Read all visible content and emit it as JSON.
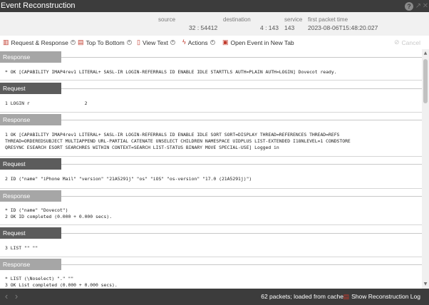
{
  "window": {
    "title": "Event Reconstruction",
    "help_icon": "?"
  },
  "meta": {
    "source_label": "source",
    "source_value": "32 : 54412",
    "destination_label": "destination",
    "destination_value": "4 : 143",
    "service_label": "service",
    "service_value": "143",
    "first_packet_label": "first packet time",
    "first_packet_value": "2023-08-06T15:48:20.027"
  },
  "toolbar": {
    "request_response": "Request & Response",
    "top_to_bottom": "Top To Bottom",
    "view_text": "View Text",
    "actions": "Actions",
    "open_event": "Open Event in New Tab",
    "cancel": "Cancel"
  },
  "sections": [
    {
      "kind": "Response",
      "lines": [
        "* OK [CAPABILITY IMAP4rev1 LITERAL+ SASL-IR LOGIN-REFERRALS ID ENABLE IDLE STARTTLS AUTH=PLAIN AUTH=LOGIN] Dovecot ready."
      ]
    },
    {
      "kind": "Request",
      "lines": [
        "1 LOGIN r                    2"
      ]
    },
    {
      "kind": "Response",
      "lines": [
        "1 OK [CAPABILITY IMAP4rev1 LITERAL+ SASL-IR LOGIN-REFERRALS ID ENABLE IDLE SORT SORT=DISPLAY THREAD=REFERENCES THREAD=REFS",
        "THREAD=ORDEREDSUBJECT MULTIAPPEND URL-PARTIAL CATENATE UNSELECT CHILDREN NAMESPACE UIDPLUS LIST-EXTENDED I18NLEVEL=1 CONDSTORE",
        "QRESYNC ESEARCH ESORT SEARCHRES WITHIN CONTEXT=SEARCH LIST-STATUS BINARY MOVE SPECIAL-USE] Logged in"
      ]
    },
    {
      "kind": "Request",
      "lines": [
        "2 ID (\"name\" \"iPhone Mail\" \"version\" \"21A5291j\" \"os\" \"iOS\" \"os-version\" \"17.0 (21A5291j)\")"
      ]
    },
    {
      "kind": "Response",
      "lines": [
        "* ID (\"name\" \"Dovecot\")",
        "2 OK ID completed (0.000 + 0.000 secs)."
      ]
    },
    {
      "kind": "Request",
      "lines": [
        "3 LIST \"\" \"\""
      ]
    },
    {
      "kind": "Response",
      "lines": [
        "* LIST (\\Noselect) \".\" \"\"",
        "3 OK List completed (0.000 + 0.000 secs)."
      ]
    }
  ],
  "footer": {
    "prev": "‹",
    "next": "›",
    "status": "62 packets; loaded from cache",
    "show_log": "Show Reconstruction Log"
  },
  "icons": {
    "help": "help-icon",
    "popout": "popout-icon",
    "close": "close-icon",
    "request_response": "split-view-icon",
    "top_to_bottom": "order-icon",
    "view_text": "document-icon",
    "actions": "lightning-icon",
    "open_event": "open-tab-icon",
    "cancel": "cancel-icon",
    "show_log": "log-icon"
  },
  "colors": {
    "titlebar": "#3c3c3c",
    "request_header": "#5c5c5c",
    "response_header": "#a6a6a6",
    "accent_red": "#c0392b"
  }
}
